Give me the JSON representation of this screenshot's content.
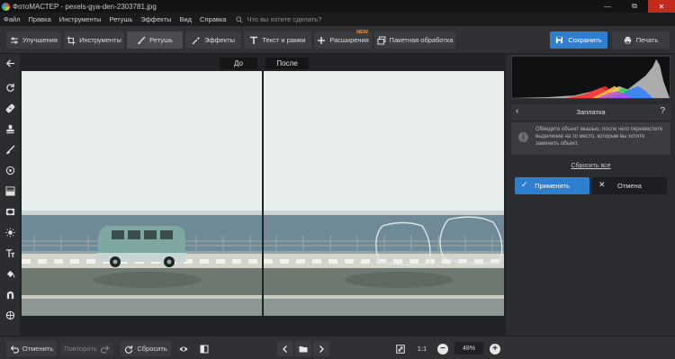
{
  "window": {
    "title": "ФотоМАСТЕР - pexels-gya-den-2303781.jpg",
    "minimize": "—",
    "maximize": "⧉",
    "close": "✕"
  },
  "menu": {
    "items": [
      "Файл",
      "Правка",
      "Инструменты",
      "Ретушь",
      "Эффекты",
      "Вид",
      "Справка"
    ],
    "search_placeholder": "Что вы хотите сделать?"
  },
  "toolbar": {
    "tabs": [
      {
        "label": "Улучшения",
        "icon": "sliders-icon"
      },
      {
        "label": "Инструменты",
        "icon": "crop-icon"
      },
      {
        "label": "Ретушь",
        "icon": "brush-icon",
        "active": true
      },
      {
        "label": "Эффекты",
        "icon": "magic-wand-icon"
      },
      {
        "label": "Текст и рамки",
        "icon": "text-icon"
      },
      {
        "label": "Расширения",
        "icon": "plus-icon",
        "badge": "NEW"
      },
      {
        "label": "Пакетная обработка",
        "icon": "batch-icon"
      }
    ],
    "save_label": "Сохранить",
    "print_label": "Печать"
  },
  "left_tools": [
    "back-arrow-icon",
    "rotate-icon",
    "patch-icon",
    "stamp-icon",
    "brush-icon",
    "radial-icon",
    "gradient-icon",
    "vignette-icon",
    "sun-icon",
    "text-icon",
    "fill-icon",
    "magnet-icon",
    "crosshair-icon"
  ],
  "canvas": {
    "before_label": "До",
    "after_label": "После"
  },
  "panel": {
    "title": "Заплатка",
    "back": "‹",
    "help": "?",
    "info_icon": "i",
    "info_text": "Обведите объект мышью, после чего переместите выделение на то место, которым вы хотите заменить объект.",
    "reset_all": "Сбросить все",
    "apply_label": "Применить",
    "cancel_label": "Отмена",
    "apply_icon": "✓",
    "cancel_icon": "✕"
  },
  "bottom": {
    "undo_label": "Отменить",
    "redo_label": "Повторить",
    "reset_label": "Сбросить",
    "one_to_one": "1:1",
    "zoom": "48%"
  },
  "colors": {
    "accent": "#2f7fcf",
    "new_badge": "#ff8a2b",
    "close": "#c42b1c"
  }
}
